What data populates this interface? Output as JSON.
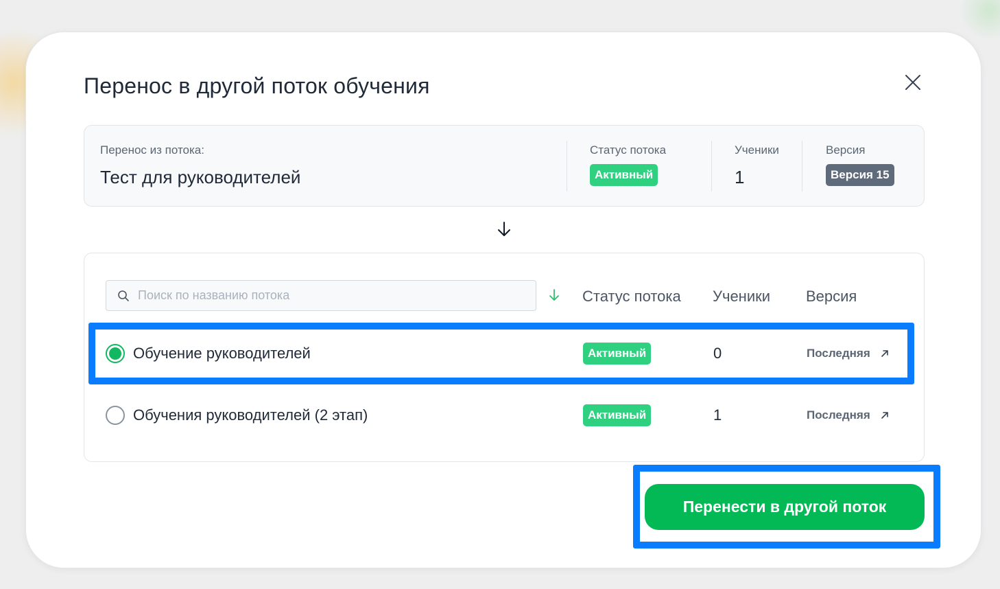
{
  "modal": {
    "title": "Перенос в другой поток обучения"
  },
  "source": {
    "label": "Перенос из потока:",
    "name": "Тест для руководителей",
    "status_label": "Статус потока",
    "status": "Активный",
    "students_label": "Ученики",
    "students": "1",
    "version_label": "Версия",
    "version": "Версия 15"
  },
  "target": {
    "search_placeholder": "Поиск по названию потока",
    "columns": {
      "status": "Статус потока",
      "students": "Ученики",
      "version": "Версия"
    },
    "rows": [
      {
        "name": "Обучение руководителей",
        "status": "Активный",
        "students": "0",
        "version": "Последняя",
        "selected": true
      },
      {
        "name": "Обучения руководителей (2 этап)",
        "status": "Активный",
        "students": "1",
        "version": "Последняя",
        "selected": false
      }
    ]
  },
  "actions": {
    "submit_label": "Перенести в другой поток"
  },
  "colors": {
    "accent": "#03b955",
    "status_active": "#2fd180",
    "version_badge": "#5f6b7a",
    "highlight": "#0a7cff"
  },
  "icons": [
    "close-icon",
    "arrow-down-icon",
    "search-icon",
    "sort-down-icon",
    "external-link-icon"
  ]
}
